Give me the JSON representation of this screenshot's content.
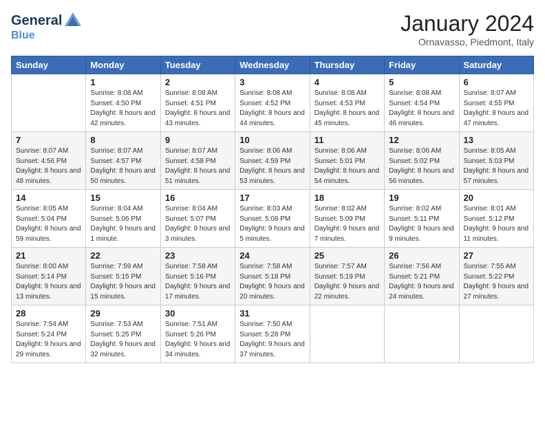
{
  "header": {
    "logo_line1": "General",
    "logo_line2": "Blue",
    "month": "January 2024",
    "location": "Ornavasso, Piedmont, Italy"
  },
  "weekdays": [
    "Sunday",
    "Monday",
    "Tuesday",
    "Wednesday",
    "Thursday",
    "Friday",
    "Saturday"
  ],
  "weeks": [
    [
      {
        "day": "",
        "sunrise": "",
        "sunset": "",
        "daylight": ""
      },
      {
        "day": "1",
        "sunrise": "Sunrise: 8:08 AM",
        "sunset": "Sunset: 4:50 PM",
        "daylight": "Daylight: 8 hours and 42 minutes."
      },
      {
        "day": "2",
        "sunrise": "Sunrise: 8:08 AM",
        "sunset": "Sunset: 4:51 PM",
        "daylight": "Daylight: 8 hours and 43 minutes."
      },
      {
        "day": "3",
        "sunrise": "Sunrise: 8:08 AM",
        "sunset": "Sunset: 4:52 PM",
        "daylight": "Daylight: 8 hours and 44 minutes."
      },
      {
        "day": "4",
        "sunrise": "Sunrise: 8:08 AM",
        "sunset": "Sunset: 4:53 PM",
        "daylight": "Daylight: 8 hours and 45 minutes."
      },
      {
        "day": "5",
        "sunrise": "Sunrise: 8:08 AM",
        "sunset": "Sunset: 4:54 PM",
        "daylight": "Daylight: 8 hours and 46 minutes."
      },
      {
        "day": "6",
        "sunrise": "Sunrise: 8:07 AM",
        "sunset": "Sunset: 4:55 PM",
        "daylight": "Daylight: 8 hours and 47 minutes."
      }
    ],
    [
      {
        "day": "7",
        "sunrise": "Sunrise: 8:07 AM",
        "sunset": "Sunset: 4:56 PM",
        "daylight": "Daylight: 8 hours and 48 minutes."
      },
      {
        "day": "8",
        "sunrise": "Sunrise: 8:07 AM",
        "sunset": "Sunset: 4:57 PM",
        "daylight": "Daylight: 8 hours and 50 minutes."
      },
      {
        "day": "9",
        "sunrise": "Sunrise: 8:07 AM",
        "sunset": "Sunset: 4:58 PM",
        "daylight": "Daylight: 8 hours and 51 minutes."
      },
      {
        "day": "10",
        "sunrise": "Sunrise: 8:06 AM",
        "sunset": "Sunset: 4:59 PM",
        "daylight": "Daylight: 8 hours and 53 minutes."
      },
      {
        "day": "11",
        "sunrise": "Sunrise: 8:06 AM",
        "sunset": "Sunset: 5:01 PM",
        "daylight": "Daylight: 8 hours and 54 minutes."
      },
      {
        "day": "12",
        "sunrise": "Sunrise: 8:06 AM",
        "sunset": "Sunset: 5:02 PM",
        "daylight": "Daylight: 8 hours and 56 minutes."
      },
      {
        "day": "13",
        "sunrise": "Sunrise: 8:05 AM",
        "sunset": "Sunset: 5:03 PM",
        "daylight": "Daylight: 8 hours and 57 minutes."
      }
    ],
    [
      {
        "day": "14",
        "sunrise": "Sunrise: 8:05 AM",
        "sunset": "Sunset: 5:04 PM",
        "daylight": "Daylight: 8 hours and 59 minutes."
      },
      {
        "day": "15",
        "sunrise": "Sunrise: 8:04 AM",
        "sunset": "Sunset: 5:06 PM",
        "daylight": "Daylight: 9 hours and 1 minute."
      },
      {
        "day": "16",
        "sunrise": "Sunrise: 8:04 AM",
        "sunset": "Sunset: 5:07 PM",
        "daylight": "Daylight: 9 hours and 3 minutes."
      },
      {
        "day": "17",
        "sunrise": "Sunrise: 8:03 AM",
        "sunset": "Sunset: 5:08 PM",
        "daylight": "Daylight: 9 hours and 5 minutes."
      },
      {
        "day": "18",
        "sunrise": "Sunrise: 8:02 AM",
        "sunset": "Sunset: 5:09 PM",
        "daylight": "Daylight: 9 hours and 7 minutes."
      },
      {
        "day": "19",
        "sunrise": "Sunrise: 8:02 AM",
        "sunset": "Sunset: 5:11 PM",
        "daylight": "Daylight: 9 hours and 9 minutes."
      },
      {
        "day": "20",
        "sunrise": "Sunrise: 8:01 AM",
        "sunset": "Sunset: 5:12 PM",
        "daylight": "Daylight: 9 hours and 11 minutes."
      }
    ],
    [
      {
        "day": "21",
        "sunrise": "Sunrise: 8:00 AM",
        "sunset": "Sunset: 5:14 PM",
        "daylight": "Daylight: 9 hours and 13 minutes."
      },
      {
        "day": "22",
        "sunrise": "Sunrise: 7:59 AM",
        "sunset": "Sunset: 5:15 PM",
        "daylight": "Daylight: 9 hours and 15 minutes."
      },
      {
        "day": "23",
        "sunrise": "Sunrise: 7:58 AM",
        "sunset": "Sunset: 5:16 PM",
        "daylight": "Daylight: 9 hours and 17 minutes."
      },
      {
        "day": "24",
        "sunrise": "Sunrise: 7:58 AM",
        "sunset": "Sunset: 5:18 PM",
        "daylight": "Daylight: 9 hours and 20 minutes."
      },
      {
        "day": "25",
        "sunrise": "Sunrise: 7:57 AM",
        "sunset": "Sunset: 5:19 PM",
        "daylight": "Daylight: 9 hours and 22 minutes."
      },
      {
        "day": "26",
        "sunrise": "Sunrise: 7:56 AM",
        "sunset": "Sunset: 5:21 PM",
        "daylight": "Daylight: 9 hours and 24 minutes."
      },
      {
        "day": "27",
        "sunrise": "Sunrise: 7:55 AM",
        "sunset": "Sunset: 5:22 PM",
        "daylight": "Daylight: 9 hours and 27 minutes."
      }
    ],
    [
      {
        "day": "28",
        "sunrise": "Sunrise: 7:54 AM",
        "sunset": "Sunset: 5:24 PM",
        "daylight": "Daylight: 9 hours and 29 minutes."
      },
      {
        "day": "29",
        "sunrise": "Sunrise: 7:53 AM",
        "sunset": "Sunset: 5:25 PM",
        "daylight": "Daylight: 9 hours and 32 minutes."
      },
      {
        "day": "30",
        "sunrise": "Sunrise: 7:51 AM",
        "sunset": "Sunset: 5:26 PM",
        "daylight": "Daylight: 9 hours and 34 minutes."
      },
      {
        "day": "31",
        "sunrise": "Sunrise: 7:50 AM",
        "sunset": "Sunset: 5:28 PM",
        "daylight": "Daylight: 9 hours and 37 minutes."
      },
      {
        "day": "",
        "sunrise": "",
        "sunset": "",
        "daylight": ""
      },
      {
        "day": "",
        "sunrise": "",
        "sunset": "",
        "daylight": ""
      },
      {
        "day": "",
        "sunrise": "",
        "sunset": "",
        "daylight": ""
      }
    ]
  ]
}
